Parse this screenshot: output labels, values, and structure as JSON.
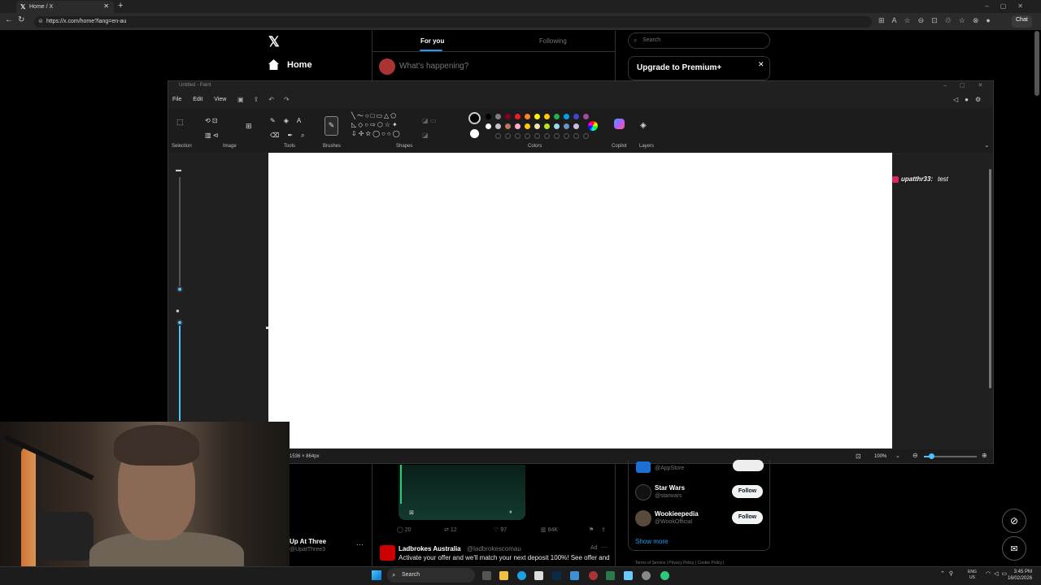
{
  "browser": {
    "tab_title": "Home / X",
    "url": "https://x.com/home?lang=en-au",
    "chat_button": "Chat"
  },
  "x": {
    "nav_home": "Home",
    "tab_for_you": "For you",
    "tab_following": "Following",
    "compose_placeholder": "What's happening?",
    "search_placeholder": "Search",
    "premium_title": "Upgrade to Premium+",
    "tweet_actions": {
      "replies": "20",
      "reposts": "12",
      "likes": "97",
      "views": "84K"
    },
    "ad": {
      "name": "Ladbrokes Australia",
      "handle": "@ladbrokescomau",
      "tag": "Ad",
      "text": "Activate your offer and we'll match your next deposit 100%! See offer and"
    },
    "sidebar_account": {
      "name": "Up At Three",
      "handle": "@UpatThree3"
    },
    "who_to_follow": [
      {
        "handle": "@AppStore",
        "follow": "Follow"
      },
      {
        "name": "Star Wars",
        "handle": "@starwars",
        "follow": "Follow"
      },
      {
        "name": "Wookieepedia",
        "handle": "@WookOfficial",
        "follow": "Follow"
      }
    ],
    "show_more": "Show more",
    "footer": "Terms of Service  |  Privacy Policy  |  Cookie Policy  |"
  },
  "paint": {
    "title": "Untitled - Paint",
    "menu": {
      "file": "File",
      "edit": "Edit",
      "view": "View"
    },
    "groups": {
      "selection": "Selection",
      "image": "Image",
      "tools": "Tools",
      "brushes": "Brushes",
      "shapes": "Shapes",
      "colors": "Colors",
      "copilot": "Copilot",
      "layers": "Layers"
    },
    "canvas_size": "1536 × 864px",
    "zoom": "100%"
  },
  "chat_overlay": {
    "user": "upatthr33:",
    "message": "test"
  },
  "taskbar": {
    "search": "Search",
    "lang_top": "ENG",
    "lang_bottom": "US",
    "time": "3:45 PM",
    "date": "16/02/2026"
  },
  "colors": {
    "accent_blue": "#1d9bf0",
    "paint_accent": "#4cc2ff",
    "palette_row1": [
      "#000000",
      "#7f7f7f",
      "#880015",
      "#ed1c24",
      "#ff7f27",
      "#fff200",
      "#ffc90e",
      "#22b14c",
      "#00a2e8",
      "#3f48cc",
      "#a349a4"
    ],
    "palette_row2": [
      "#ffffff",
      "#c3c3c3",
      "#b97a57",
      "#ffaec9",
      "#ffc90e",
      "#efe4b0",
      "#b5e61d",
      "#99d9ea",
      "#7092be",
      "#c8bfe7"
    ]
  }
}
